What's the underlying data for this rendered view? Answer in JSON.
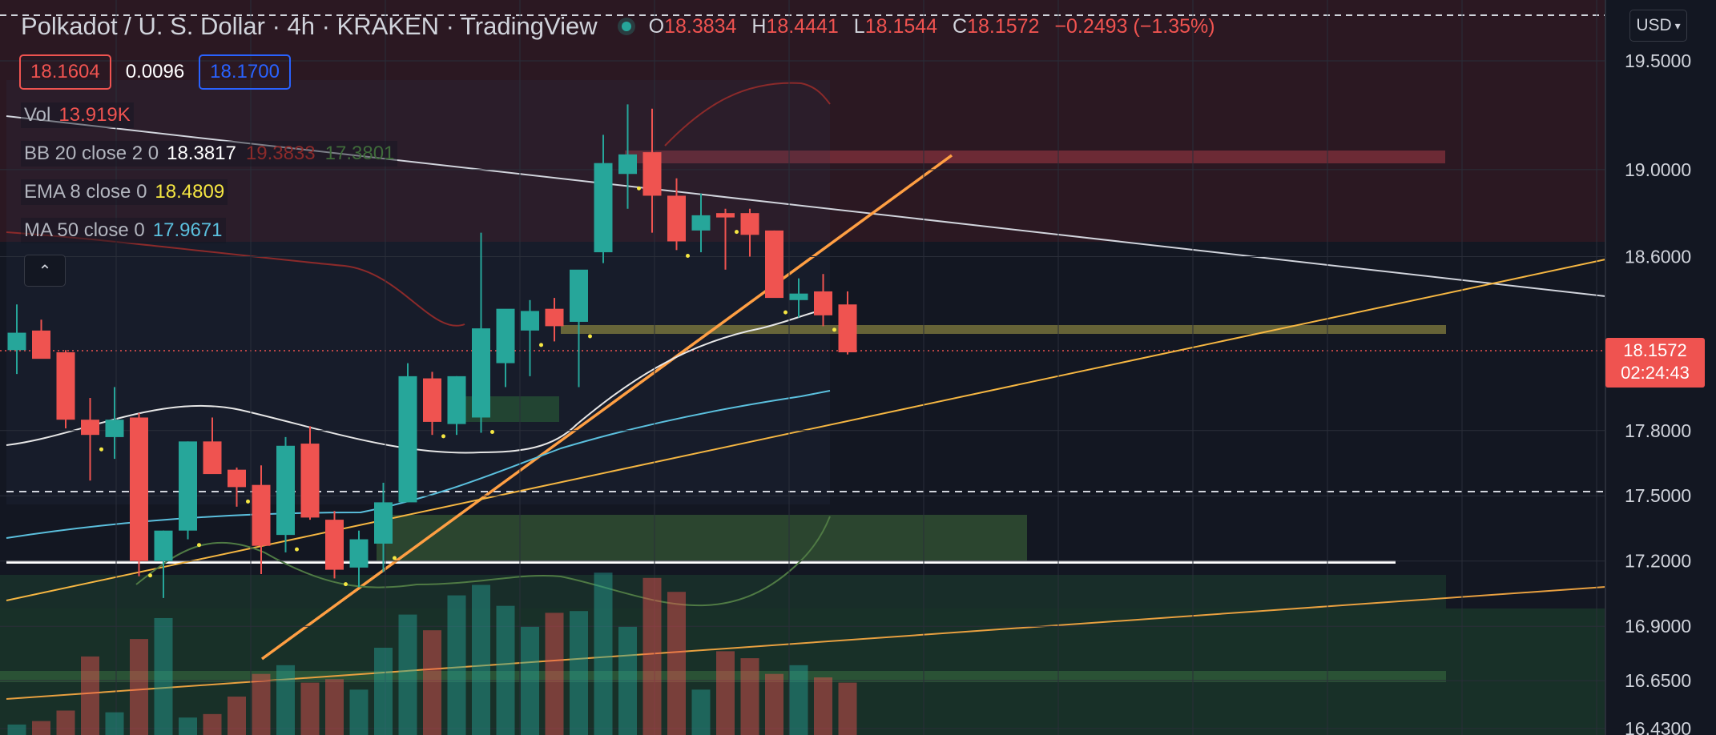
{
  "header": {
    "title": "Polkadot / U. S. Dollar · 4h · KRAKEN · TradingView",
    "ohlc": [
      {
        "key": "O",
        "value": "18.3834"
      },
      {
        "key": "H",
        "value": "18.4441"
      },
      {
        "key": "L",
        "value": "18.1544"
      },
      {
        "key": "C",
        "value": "18.1572"
      }
    ],
    "change": "−0.2493 (−1.35%)"
  },
  "ticker": {
    "bid": "18.1604",
    "spread": "0.0096",
    "ask": "18.1700"
  },
  "legends": {
    "vol": {
      "name": "Vol",
      "value": "13.919K"
    },
    "bb": {
      "name": "BB 20 close 2 0",
      "basis": "18.3817",
      "upper": "19.3833",
      "lower": "17.3801"
    },
    "ema": {
      "name": "EMA 8 close 0",
      "value": "18.4809"
    },
    "ma": {
      "name": "MA 50 close 0",
      "value": "17.9671"
    }
  },
  "currency_button": "USD",
  "last_price": {
    "value": "18.1572",
    "countdown": "02:24:43"
  },
  "colors": {
    "background": "#131722",
    "up": "#26a69a",
    "down": "#ef5350",
    "ema": "#f5e642",
    "ma": "#5bc0de",
    "bb": "#8b2a2a",
    "trend": "#ff9f43"
  },
  "icons": {
    "collapse": "chevron-up-icon",
    "currency_dropdown": "chevron-down-icon"
  },
  "chart_data": {
    "type": "candlestick",
    "price_axis": {
      "range": [
        16.4,
        19.78
      ],
      "ticks": [
        "19.5000",
        "19.0000",
        "18.6000",
        "17.8000",
        "17.5000",
        "17.2000",
        "16.9000",
        "16.6500",
        "16.4300"
      ],
      "tick_values": [
        19.5,
        19.0,
        18.6,
        17.8,
        17.5,
        17.2,
        16.9,
        16.65,
        16.43
      ],
      "grid": true
    },
    "candles": [
      {
        "o": 18.17,
        "h": 18.38,
        "l": 18.06,
        "c": 18.25
      },
      {
        "o": 18.26,
        "h": 18.31,
        "l": 18.15,
        "c": 18.13
      },
      {
        "o": 18.16,
        "h": 18.17,
        "l": 17.81,
        "c": 17.85
      },
      {
        "o": 17.85,
        "h": 17.95,
        "l": 17.57,
        "c": 17.78
      },
      {
        "o": 17.77,
        "h": 18.0,
        "l": 17.67,
        "c": 17.85
      },
      {
        "o": 17.86,
        "h": 17.88,
        "l": 17.13,
        "c": 17.2
      },
      {
        "o": 17.2,
        "h": 17.34,
        "l": 17.03,
        "c": 17.34
      },
      {
        "o": 17.34,
        "h": 17.75,
        "l": 17.3,
        "c": 17.75
      },
      {
        "o": 17.75,
        "h": 17.86,
        "l": 17.61,
        "c": 17.6
      },
      {
        "o": 17.62,
        "h": 17.63,
        "l": 17.45,
        "c": 17.54
      },
      {
        "o": 17.55,
        "h": 17.64,
        "l": 17.14,
        "c": 17.27
      },
      {
        "o": 17.32,
        "h": 17.77,
        "l": 17.24,
        "c": 17.73
      },
      {
        "o": 17.74,
        "h": 17.82,
        "l": 17.39,
        "c": 17.4
      },
      {
        "o": 17.39,
        "h": 17.43,
        "l": 17.12,
        "c": 17.16
      },
      {
        "o": 17.17,
        "h": 17.34,
        "l": 17.08,
        "c": 17.3
      },
      {
        "o": 17.28,
        "h": 17.56,
        "l": 17.15,
        "c": 17.47
      },
      {
        "o": 17.47,
        "h": 18.11,
        "l": 17.47,
        "c": 18.05
      },
      {
        "o": 18.04,
        "h": 18.07,
        "l": 17.78,
        "c": 17.84
      },
      {
        "o": 17.83,
        "h": 18.05,
        "l": 17.78,
        "c": 18.05
      },
      {
        "o": 17.86,
        "h": 18.71,
        "l": 17.79,
        "c": 18.27
      },
      {
        "o": 18.11,
        "h": 18.3,
        "l": 18.0,
        "c": 18.36
      },
      {
        "o": 18.26,
        "h": 18.4,
        "l": 18.05,
        "c": 18.35
      },
      {
        "o": 18.36,
        "h": 18.41,
        "l": 18.21,
        "c": 18.28
      },
      {
        "o": 18.3,
        "h": 18.53,
        "l": 18.0,
        "c": 18.54
      },
      {
        "o": 18.62,
        "h": 19.16,
        "l": 18.57,
        "c": 19.03
      },
      {
        "o": 18.98,
        "h": 19.3,
        "l": 18.82,
        "c": 19.07
      },
      {
        "o": 19.08,
        "h": 19.28,
        "l": 18.71,
        "c": 18.88
      },
      {
        "o": 18.88,
        "h": 18.96,
        "l": 18.63,
        "c": 18.67
      },
      {
        "o": 18.72,
        "h": 18.89,
        "l": 18.62,
        "c": 18.79
      },
      {
        "o": 18.8,
        "h": 18.82,
        "l": 18.54,
        "c": 18.78
      },
      {
        "o": 18.8,
        "h": 18.82,
        "l": 18.6,
        "c": 18.7
      },
      {
        "o": 18.72,
        "h": 18.72,
        "l": 18.43,
        "c": 18.41
      },
      {
        "o": 18.4,
        "h": 18.5,
        "l": 18.32,
        "c": 18.43
      },
      {
        "o": 18.44,
        "h": 18.52,
        "l": 18.28,
        "c": 18.33
      },
      {
        "o": 18.38,
        "h": 18.44,
        "l": 18.15,
        "c": 18.16
      }
    ],
    "volume": [
      0.06,
      0.08,
      0.14,
      0.45,
      0.13,
      0.55,
      0.67,
      0.1,
      0.12,
      0.22,
      0.35,
      0.4,
      0.3,
      0.32,
      0.26,
      0.5,
      0.69,
      0.6,
      0.8,
      0.86,
      0.74,
      0.62,
      0.7,
      0.71,
      0.93,
      0.62,
      0.9,
      0.82,
      0.26,
      0.48,
      0.44,
      0.35,
      0.4,
      0.33,
      0.3
    ]
  }
}
